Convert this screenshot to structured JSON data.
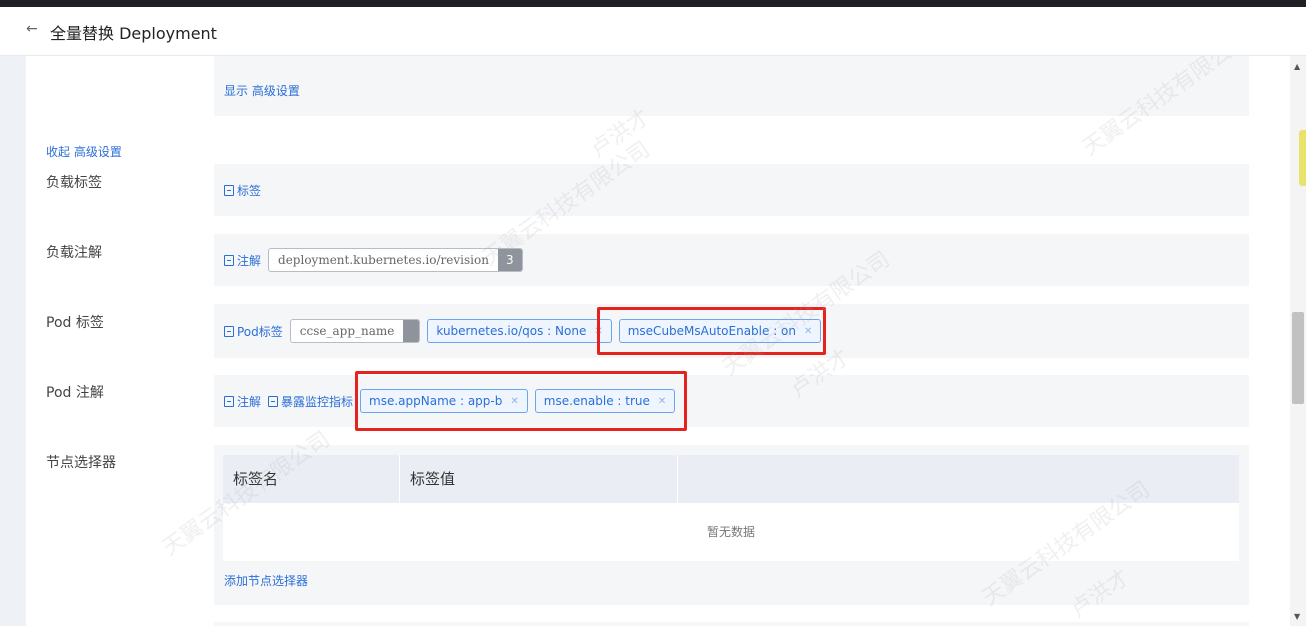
{
  "header": {
    "back_icon": "arrow-left-icon",
    "title": "全量替换 Deployment"
  },
  "advanced": {
    "show_link": "显示 高级设置",
    "collapse_link": "收起 高级设置"
  },
  "workload_labels": {
    "label": "负载标签",
    "add_link": "标签"
  },
  "workload_annotations": {
    "label": "负载注解",
    "add_link": "注解",
    "tags": [
      {
        "key": "deployment.kubernetes.io/revision",
        "value": "3"
      }
    ]
  },
  "pod_labels": {
    "label": "Pod 标签",
    "add_link": "Pod标签",
    "gray_tag": {
      "key": "ccse_app_name",
      "value": ""
    },
    "tags": [
      "kubernetes.io/qos : None",
      "mseCubeMsAutoEnable : on"
    ]
  },
  "pod_annotations": {
    "label": "Pod 注解",
    "add_link": "注解",
    "metrics_link": "暴露监控指标",
    "tags": [
      "mse.appName : app-b",
      "mse.enable : true"
    ]
  },
  "node_selector": {
    "label": "节点选择器",
    "columns": [
      "标签名",
      "标签值",
      ""
    ],
    "empty_text": "暂无数据",
    "add_link": "添加节点选择器"
  },
  "watermark": {
    "text": "天翼云科技有限公司",
    "name": "卢洪才"
  },
  "colors": {
    "link": "#2b6fd6",
    "highlight": "#e5221d",
    "panel": "#f5f6f8"
  }
}
